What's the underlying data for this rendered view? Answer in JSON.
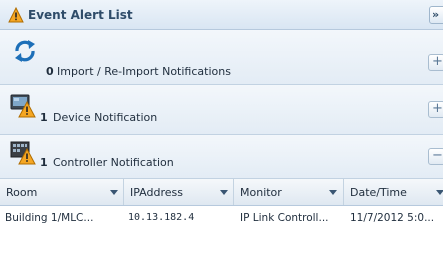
{
  "panel": {
    "title": "Event Alert List",
    "collapse_glyph": "»",
    "title_icon": "warning-icon"
  },
  "sections": [
    {
      "icon": "refresh-icon",
      "count": "0",
      "label": "Import / Re-Import Notifications",
      "toggle": "+"
    },
    {
      "icon": "device-warning-icon",
      "count": "1",
      "label": "Device Notification",
      "toggle": "+"
    },
    {
      "icon": "controller-warning-icon",
      "count": "1",
      "label": "Controller Notification",
      "toggle": "−"
    }
  ],
  "grid": {
    "columns": [
      "Room",
      "IPAddress",
      "Monitor",
      "Date/Time"
    ],
    "rows": [
      [
        "Building 1/MLC...",
        "10.13.182.4",
        "IP Link Controll...",
        "11/7/2012 5:0..."
      ]
    ]
  },
  "colors": {
    "accent": "#2f4c69",
    "warning": "#f5a623",
    "refresh": "#1d6fb8"
  }
}
